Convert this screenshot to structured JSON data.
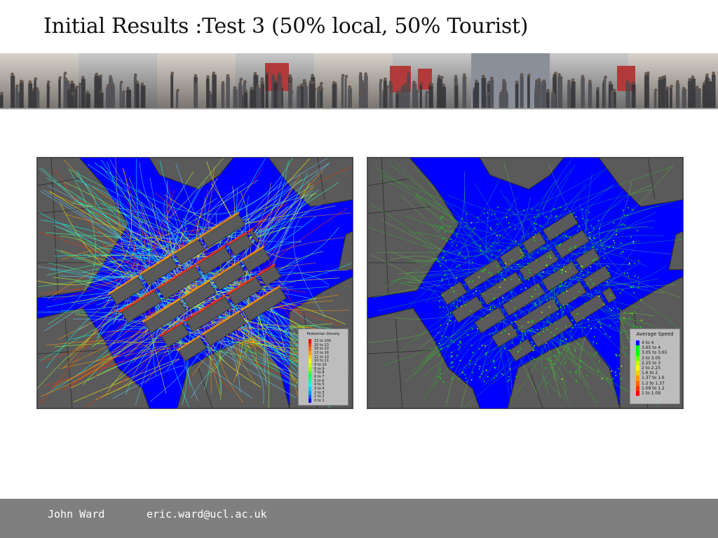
{
  "slide": {
    "title": "Initial Results :Test 3 (50% local, 50% Tourist)"
  },
  "banner": {
    "description": "crowd photo strip"
  },
  "maps": {
    "left": {
      "legend_title": "Pedestrian Density",
      "legend_items": [
        {
          "label": "23 to 100",
          "color": "#ff0000"
        },
        {
          "label": "20 to 23",
          "color": "#ff3300"
        },
        {
          "label": "16 to 20",
          "color": "#ff6600"
        },
        {
          "label": "13 to 16",
          "color": "#ff9900"
        },
        {
          "label": "11 to 13",
          "color": "#ffcc00"
        },
        {
          "label": "10 to 11",
          "color": "#ffff00"
        },
        {
          "label": "9 to 10",
          "color": "#ccff00"
        },
        {
          "label": "8 to 9",
          "color": "#99ff00"
        },
        {
          "label": "7 to 8",
          "color": "#33ff33"
        },
        {
          "label": "6 to 7",
          "color": "#00ff66"
        },
        {
          "label": "5 to 6",
          "color": "#00ffaa"
        },
        {
          "label": "4 to 5",
          "color": "#00ffee"
        },
        {
          "label": "3 to 4",
          "color": "#00ccff"
        },
        {
          "label": "2 to 3",
          "color": "#0099ff"
        },
        {
          "label": "1 to 2",
          "color": "#0055ff"
        },
        {
          "label": "0 to 1",
          "color": "#0000ff"
        }
      ]
    },
    "right": {
      "legend_title": "Average Speed",
      "legend_items": [
        {
          "label": "4 to 4",
          "color": "#0000ff"
        },
        {
          "label": "3.65 to 4",
          "color": "#00ff00"
        },
        {
          "label": "3.05 to 3.65",
          "color": "#00ff00"
        },
        {
          "label": "3 to 3.05",
          "color": "#66ff00"
        },
        {
          "label": "2.25 to 3",
          "color": "#ccff00"
        },
        {
          "label": "2 to 2.25",
          "color": "#ffff00"
        },
        {
          "label": "1.6 to 2",
          "color": "#ffcc00"
        },
        {
          "label": "1.37 to 1.6",
          "color": "#ff9900"
        },
        {
          "label": "1.2 to 1.37",
          "color": "#ff6600"
        },
        {
          "label": "1.09 to 1.2",
          "color": "#ff3300"
        },
        {
          "label": "1 to 1.09",
          "color": "#ff0000"
        }
      ]
    }
  },
  "footer": {
    "author": "John Ward",
    "email": "eric.ward@ucl.ac.uk"
  },
  "colors": {
    "building": "#5a5a5a",
    "open_space": "#0000ff",
    "footer_bg": "#7f7f7f"
  }
}
